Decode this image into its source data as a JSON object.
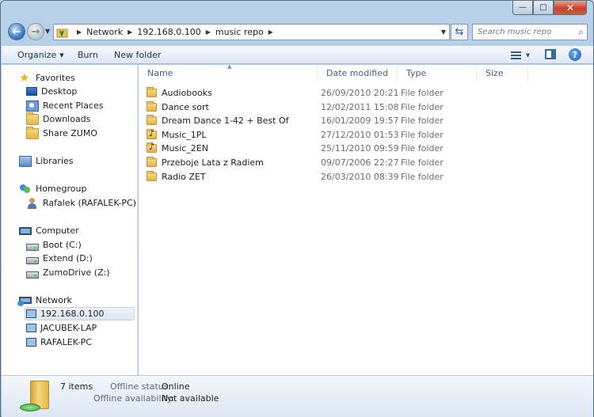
{
  "window": {
    "caption_buttons": {
      "minimize": "—",
      "maximize": "□",
      "close": "✕"
    }
  },
  "address": {
    "crumbs": [
      "Network",
      "192.168.0.100",
      "music repo"
    ]
  },
  "search": {
    "placeholder": "Search music repo"
  },
  "toolbar": {
    "organize": "Organize",
    "burn": "Burn",
    "new_folder": "New folder"
  },
  "sidebar": {
    "favorites": {
      "label": "Favorites",
      "items": [
        "Desktop",
        "Recent Places",
        "Downloads",
        "Share ZUMO"
      ]
    },
    "libraries": {
      "label": "Libraries"
    },
    "homegroup": {
      "label": "Homegroup",
      "items": [
        "Rafalek (RAFALEK-PC)"
      ]
    },
    "computer": {
      "label": "Computer",
      "items": [
        "Boot (C:)",
        "Extend (D:)",
        "ZumoDrive (Z:)"
      ]
    },
    "network": {
      "label": "Network",
      "items": [
        "192.168.0.100",
        "JACUBEK-LAP",
        "RAFALEK-PC"
      ],
      "selected": "192.168.0.100"
    }
  },
  "columns": {
    "name": "Name",
    "date": "Date modified",
    "type": "Type",
    "size": "Size"
  },
  "files": [
    {
      "name": "Audiobooks",
      "date": "26/09/2010 20:21",
      "type": "File folder",
      "icon": "folder-icon"
    },
    {
      "name": "Dance sort",
      "date": "12/02/2011 15:08",
      "type": "File folder",
      "icon": "folder-icon"
    },
    {
      "name": "Dream Dance 1-42 + Best Of",
      "date": "16/01/2009 19:57",
      "type": "File folder",
      "icon": "folder-icon"
    },
    {
      "name": "Music_1PL",
      "date": "27/12/2010 01:53",
      "type": "File folder",
      "icon": "music-folder-icon"
    },
    {
      "name": "Music_2EN",
      "date": "25/11/2010 09:59",
      "type": "File folder",
      "icon": "music-folder-icon"
    },
    {
      "name": "Przeboje Lata z Radiem",
      "date": "09/07/2006 22:27",
      "type": "File folder",
      "icon": "folder-icon"
    },
    {
      "name": "Radio ZET",
      "date": "26/03/2010 08:39",
      "type": "File folder",
      "icon": "folder-icon"
    }
  ],
  "details": {
    "count": "7 items",
    "offline_status_label": "Offline status:",
    "offline_status_value": "Online",
    "offline_availability_label": "Offline availability:",
    "offline_availability_value": "Not available"
  }
}
